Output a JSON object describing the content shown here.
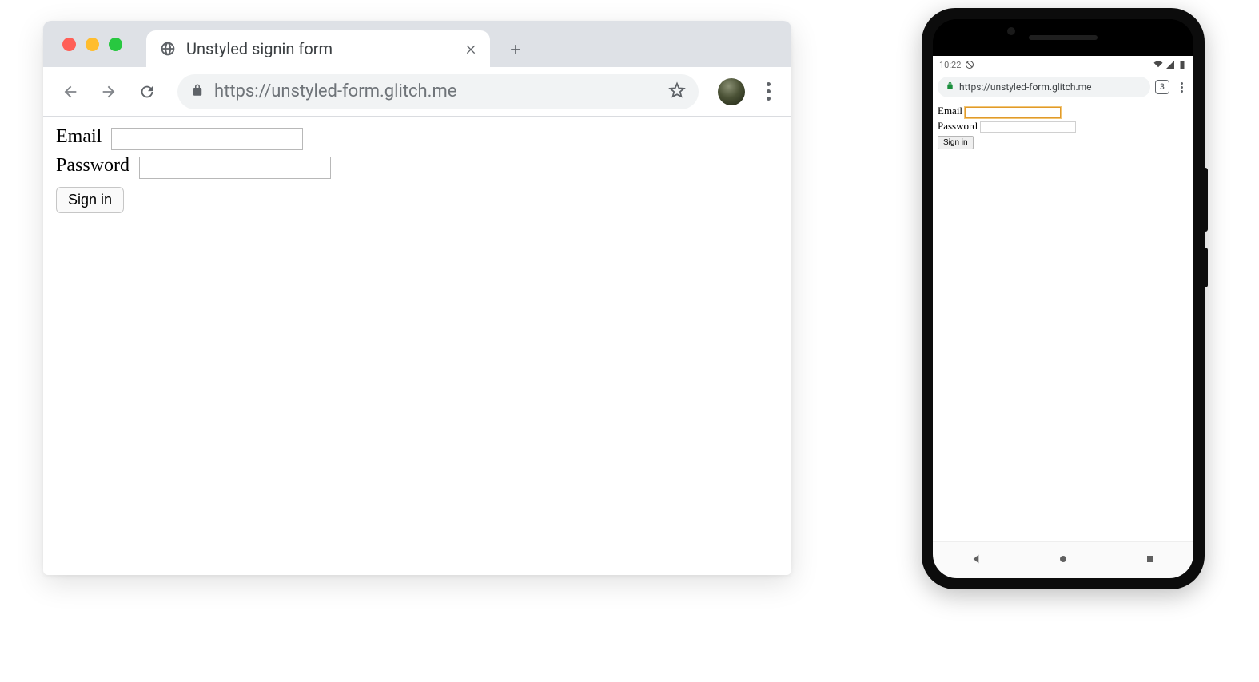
{
  "desktop": {
    "tab": {
      "title": "Unstyled signin form"
    },
    "url": "https://unstyled-form.glitch.me",
    "form": {
      "email_label": "Email",
      "password_label": "Password",
      "signin_label": "Sign in"
    }
  },
  "mobile": {
    "status": {
      "time": "10:22"
    },
    "url": "https://unstyled-form.glitch.me",
    "tab_count": "3",
    "form": {
      "email_label": "Email",
      "password_label": "Password",
      "signin_label": "Sign in"
    }
  }
}
